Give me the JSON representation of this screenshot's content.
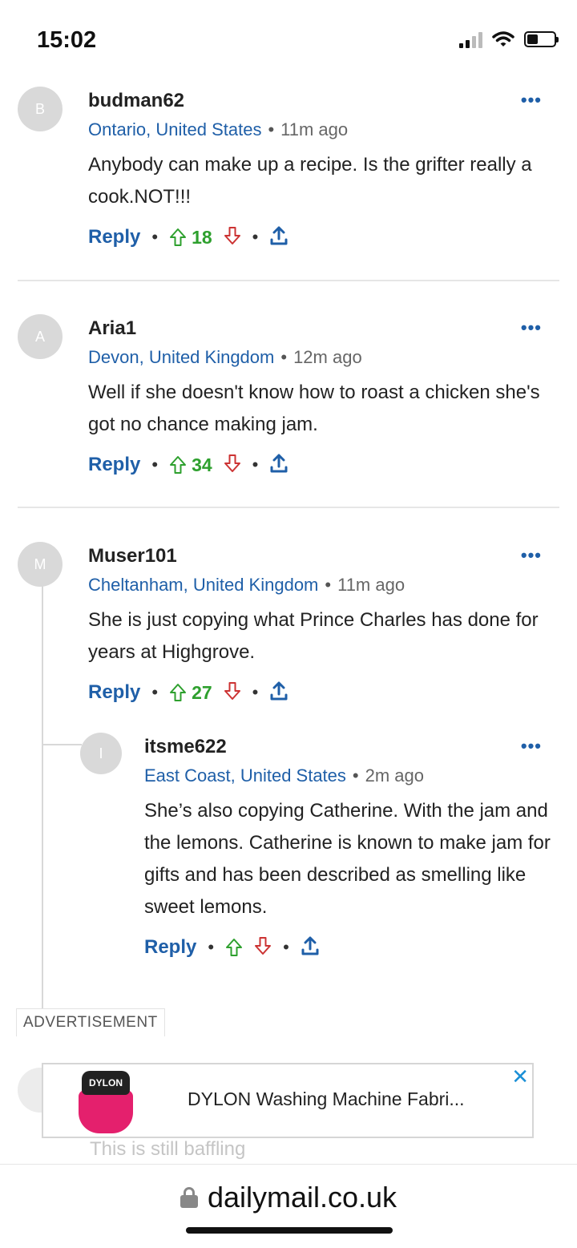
{
  "status_bar": {
    "time": "15:02"
  },
  "comments": [
    {
      "avatar_letter": "B",
      "username": "budman62",
      "location": "Ontario, United States",
      "time": "11m ago",
      "text": "Anybody can make up a recipe. Is the grifter really a cook.NOT!!!",
      "reply_label": "Reply",
      "upvotes": "18"
    },
    {
      "avatar_letter": "A",
      "username": "Aria1",
      "location": "Devon, United Kingdom",
      "time": "12m ago",
      "text": "Well if she doesn't know how to roast a chicken she's got no chance making jam.",
      "reply_label": "Reply",
      "upvotes": "34"
    },
    {
      "avatar_letter": "M",
      "username": "Muser101",
      "location": "Cheltanham, United Kingdom",
      "time": "11m ago",
      "text": "She is just copying what Prince Charles has done for years at Highgrove.",
      "reply_label": "Reply",
      "upvotes": "27"
    },
    {
      "avatar_letter": "I",
      "username": "itsme622",
      "location": "East Coast, United States",
      "time": "2m ago",
      "text": "She’s also copying Catherine. With the jam and the lemons. Catherine is known to make jam for gifts and has been described as smelling like sweet lemons.",
      "reply_label": "Reply",
      "upvotes": ""
    }
  ],
  "meta_separator": "•",
  "more_label": "•••",
  "advertisement": {
    "label": "ADVERTISEMENT",
    "title": "DYLON Washing Machine Fabri...",
    "product_brand": "DYLON",
    "close_label": "✕"
  },
  "faded_comment_text": "This is still baffling",
  "browser": {
    "url": "dailymail.co.uk"
  },
  "colors": {
    "link_blue": "#1f5fa8",
    "upvote_green": "#2ea02e",
    "downvote_red": "#c33333",
    "ad_product_pink": "#e4206d"
  }
}
